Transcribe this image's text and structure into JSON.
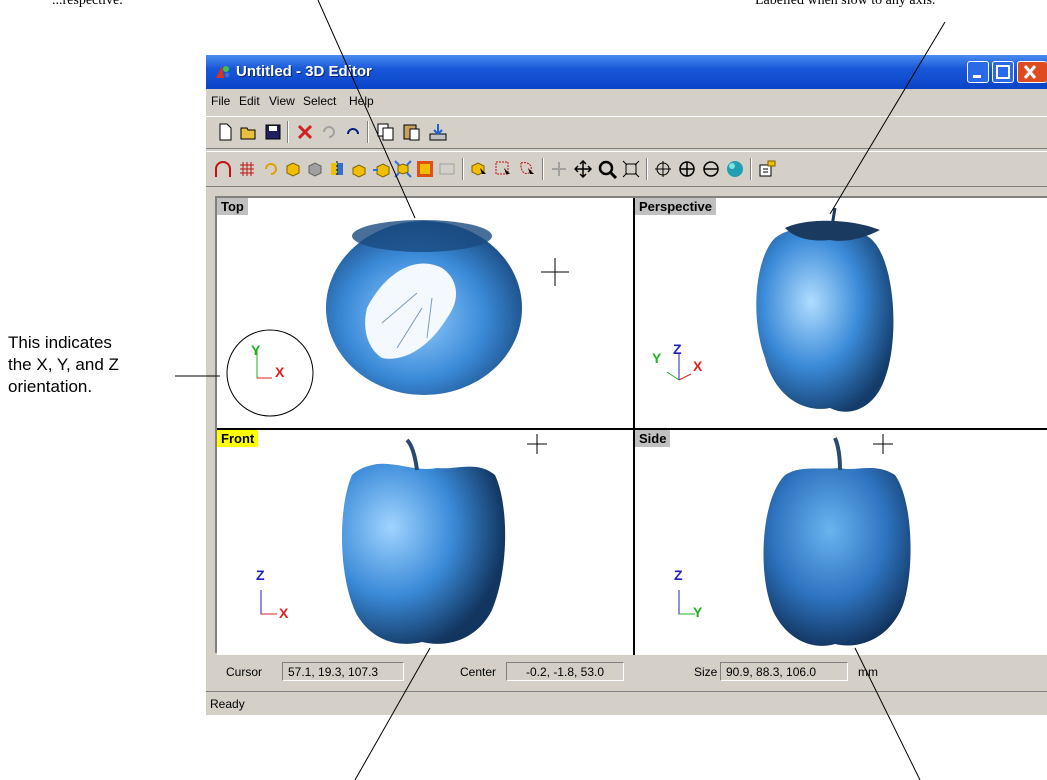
{
  "annotations": {
    "top_left_cut": "...respective.",
    "top_right_cut": "Labelled when slow to any axis.",
    "orientation_callout": [
      "This indicates",
      "the X, Y, and Z",
      "orientation."
    ]
  },
  "window": {
    "title": "Untitled - 3D Editor"
  },
  "menu": [
    "File",
    "Edit",
    "View",
    "Select",
    "Help"
  ],
  "toolbar1_icons": [
    "new-icon",
    "open-icon",
    "save-icon",
    "delete-icon",
    "undo-icon",
    "redo-icon",
    "copy-icon",
    "paste-icon",
    "import-icon"
  ],
  "toolbar2_icons": [
    "arc-icon",
    "grid-icon",
    "rotate-icon",
    "cube-icon",
    "extrude-icon",
    "mirror-icon",
    "scale-icon",
    "move-icon",
    "stretch-icon",
    "fit-icon",
    "select-icon",
    "select-box-icon",
    "select-lasso-icon",
    "pan-icon",
    "move-view-icon",
    "zoom-icon",
    "zoom-extents-icon",
    "orbit-icon",
    "orbit-xyz-icon",
    "rotate-view-icon",
    "sphere-render-icon",
    "view-options-icon"
  ],
  "viewports": [
    {
      "id": "top",
      "label": "Top",
      "axis1": "Y",
      "axis2": "X"
    },
    {
      "id": "perspective",
      "label": "Perspective",
      "axis1": "Y",
      "axis2": "Z",
      "axis3": "X"
    },
    {
      "id": "front",
      "label": "Front",
      "axis1": "Z",
      "axis2": "X"
    },
    {
      "id": "side",
      "label": "Side",
      "axis1": "Z",
      "axis2": "Y"
    }
  ],
  "status": {
    "cursor_label": "Cursor",
    "cursor_value": "57.1, 19.3, 107.3",
    "center_label": "Center",
    "center_value": "-0.2, -1.8, 53.0",
    "size_label": "Size",
    "size_value": "90.9, 88.3, 106.0",
    "unit": "mm",
    "ready": "Ready"
  },
  "colors": {
    "apple": "#3a8ad8",
    "axis_x": "#e02020",
    "axis_y": "#20b020",
    "axis_z": "#2020c0",
    "front_label_bg": "#ffff00",
    "other_label_bg": "#c0c0c0"
  }
}
